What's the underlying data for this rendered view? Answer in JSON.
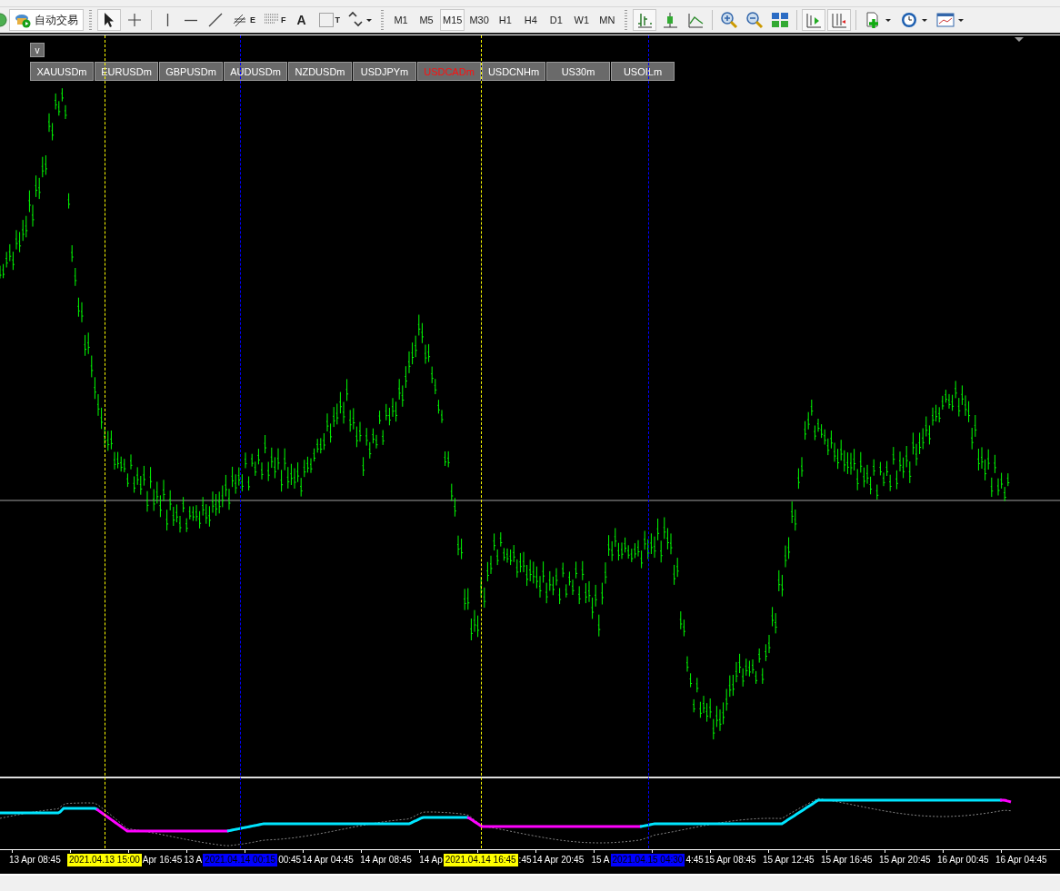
{
  "toolbar": {
    "auto_trading": {
      "label": "自动交易"
    },
    "tools": [
      {
        "kind": "cursor",
        "selected": true
      },
      {
        "kind": "crosshair",
        "selected": false
      },
      {
        "kind": "vline",
        "selected": false
      },
      {
        "kind": "hline",
        "selected": false
      },
      {
        "kind": "trendline",
        "selected": false
      },
      {
        "kind": "channel",
        "glyph": "E",
        "selected": false
      },
      {
        "kind": "fibo",
        "glyph": "F",
        "selected": false
      },
      {
        "kind": "text",
        "glyph": "A",
        "selected": false
      },
      {
        "kind": "label",
        "glyph": "T",
        "selected": false
      },
      {
        "kind": "shapes",
        "selected": false
      }
    ],
    "timeframes": [
      {
        "label": "M1",
        "selected": false
      },
      {
        "label": "M5",
        "selected": false
      },
      {
        "label": "M15",
        "selected": true
      },
      {
        "label": "M30",
        "selected": false
      },
      {
        "label": "H1",
        "selected": false
      },
      {
        "label": "H4",
        "selected": false
      },
      {
        "label": "D1",
        "selected": false
      },
      {
        "label": "W1",
        "selected": false
      },
      {
        "label": "MN",
        "selected": false
      }
    ],
    "chart_types": [
      {
        "kind": "bars",
        "selected": true
      },
      {
        "kind": "candles",
        "selected": false
      },
      {
        "kind": "line",
        "selected": false
      }
    ],
    "zoom": [
      {
        "kind": "zoom_in"
      },
      {
        "kind": "zoom_out"
      },
      {
        "kind": "tile"
      }
    ],
    "toggles": [
      {
        "kind": "auto_scroll",
        "on": true
      },
      {
        "kind": "chart_shift",
        "on": true
      }
    ],
    "menus": [
      {
        "kind": "indicators"
      },
      {
        "kind": "periods"
      },
      {
        "kind": "templates"
      }
    ]
  },
  "chart": {
    "collapse_button": "v",
    "symbols": [
      {
        "label": "XAUUSDm",
        "highlighted": false
      },
      {
        "label": "EURUSDm",
        "highlighted": false
      },
      {
        "label": "GBPUSDm",
        "highlighted": false
      },
      {
        "label": "AUDUSDm",
        "highlighted": false
      },
      {
        "label": "NZDUSDm",
        "highlighted": false
      },
      {
        "label": "USDJPYm",
        "highlighted": false
      },
      {
        "label": "USDCADm",
        "highlighted": true
      },
      {
        "label": "USDCNHm",
        "highlighted": false
      },
      {
        "label": "US30m",
        "highlighted": false
      },
      {
        "label": "USOILm",
        "highlighted": false
      }
    ],
    "vertical_lines": [
      {
        "time": "2021.04.13 15:00",
        "color": "#ffff00"
      },
      {
        "time": "2021.04.14 00:15",
        "color": "#0000ff"
      },
      {
        "time": "2021.04.14 16:45",
        "color": "#ffff00"
      },
      {
        "time": "2021.04.15 04:30",
        "color": "#0000ff"
      }
    ],
    "time_axis": [
      {
        "text": "13 Apr 08:45",
        "kind": "full"
      },
      {
        "text": "Apr 16:45",
        "kind": "tail"
      },
      {
        "text": "13 A",
        "kind": "head"
      },
      {
        "text": "00:45",
        "kind": "tail"
      },
      {
        "text": "14 Apr 04:45",
        "kind": "full"
      },
      {
        "text": "14 Apr 08:45",
        "kind": "full"
      },
      {
        "text": "14 Ap",
        "kind": "head"
      },
      {
        "text": ":45",
        "kind": "tail"
      },
      {
        "text": "14 Apr 20:45",
        "kind": "full"
      },
      {
        "text": "15 A",
        "kind": "head"
      },
      {
        "text": "4:45",
        "kind": "tail"
      },
      {
        "text": "15 Apr 08:45",
        "kind": "full"
      },
      {
        "text": "15 Apr 12:45",
        "kind": "full"
      },
      {
        "text": "15 Apr 16:45",
        "kind": "full"
      },
      {
        "text": "15 Apr 20:45",
        "kind": "full"
      },
      {
        "text": "16 Apr 00:45",
        "kind": "full"
      },
      {
        "text": "16 Apr 04:45",
        "kind": "full"
      }
    ]
  }
}
